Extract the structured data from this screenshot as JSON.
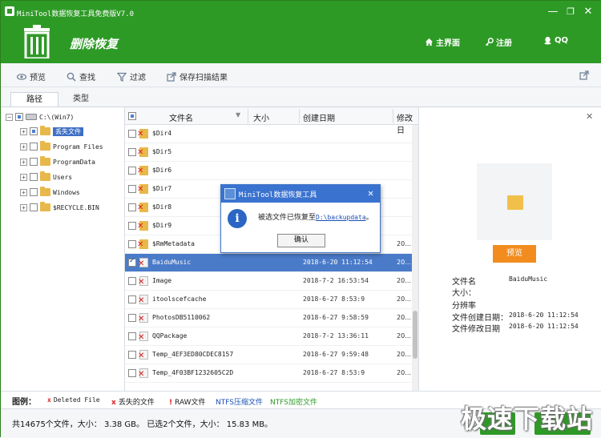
{
  "window": {
    "title": "MiniTool数据恢复工具免费版V7.0",
    "minimize": "—",
    "restore": "❐",
    "close": "✕"
  },
  "header": {
    "title": "删除恢复",
    "nav": [
      {
        "label": "主界面",
        "icon": "home-icon"
      },
      {
        "label": "注册",
        "icon": "key-icon"
      },
      {
        "label": "QQ",
        "icon": "qq-icon"
      }
    ]
  },
  "toolbar": {
    "preview": "预览",
    "find": "查找",
    "filter": "过滤",
    "save_scan": "保存扫描结果"
  },
  "tabs": [
    "路径",
    "类型"
  ],
  "tree": [
    {
      "label": "C:\\(Win7)",
      "level": 0
    },
    {
      "label": "丢失文件",
      "level": 1,
      "selected": true
    },
    {
      "label": "Program Files",
      "level": 1
    },
    {
      "label": "ProgramData",
      "level": 1
    },
    {
      "label": "Users",
      "level": 1
    },
    {
      "label": "Windows",
      "level": 1
    },
    {
      "label": "$RECYCLE.BIN",
      "level": 1
    }
  ],
  "list": {
    "headers": {
      "name": "文件名",
      "size": "大小",
      "created": "创建日期",
      "modified": "修改日"
    },
    "rows": [
      {
        "name": "$Dir4",
        "date": "",
        "mod": "",
        "type": "folder"
      },
      {
        "name": "$Dir5",
        "date": "",
        "mod": "",
        "type": "folder"
      },
      {
        "name": "$Dir6",
        "date": "",
        "mod": "",
        "type": "folder"
      },
      {
        "name": "$Dir7",
        "date": "",
        "mod": "",
        "type": "folder"
      },
      {
        "name": "$Dir8",
        "date": "",
        "mod": "",
        "type": "folder"
      },
      {
        "name": "$Dir9",
        "date": "",
        "mod": "",
        "type": "folder"
      },
      {
        "name": "$RmMetadata",
        "date": "",
        "mod": "20…",
        "type": "folder"
      },
      {
        "name": "BaiduMusic",
        "date": "2018-6-20 11:12:54",
        "mod": "20…",
        "type": "deleted",
        "selected": true
      },
      {
        "name": "Image",
        "date": "2018-7-2 16:53:54",
        "mod": "20…",
        "type": "deleted"
      },
      {
        "name": "itoolscefcache",
        "date": "2018-6-27 8:53:9",
        "mod": "20…",
        "type": "deleted"
      },
      {
        "name": "PhotosDB5110062",
        "date": "2018-6-27 9:58:59",
        "mod": "20…",
        "type": "deleted"
      },
      {
        "name": "QQPackage",
        "date": "2018-7-2 13:36:11",
        "mod": "20…",
        "type": "deleted"
      },
      {
        "name": "Temp_4EF3ED80CDEC8157",
        "date": "2018-6-27 9:59:48",
        "mod": "20…",
        "type": "deleted"
      },
      {
        "name": "Temp_4F03BF1232605C2D",
        "date": "2018-6-27 8:53:9",
        "mod": "20…",
        "type": "deleted"
      }
    ]
  },
  "preview": {
    "button": "预览",
    "fields": [
      {
        "label": "文件名",
        "value": "BaiduMusic"
      },
      {
        "label": "大小：",
        "value": ""
      },
      {
        "label": "分辨率",
        "value": ""
      },
      {
        "label": "文件创建日期：",
        "value": "2018-6-20 11:12:54"
      },
      {
        "label": "文件修改日期",
        "value": "2018-6-20 11:12:54"
      }
    ]
  },
  "legend": {
    "title": "图例：",
    "deleted": "Deleted File",
    "lost": "丢失的文件",
    "raw": "RAW文件",
    "ntfs_compressed": "NTFS压缩文件",
    "ntfs_encrypted": "NTFS加密文件"
  },
  "status": {
    "text": "共14675个文件，大小： 3.38 GB。 已选2个文件，大小： 15.83 MB。",
    "btn1": "",
    "btn2": "",
    "watermark": "极速下载站"
  },
  "dialog": {
    "title": "MiniTool数据恢复工具",
    "message": "被选文件已恢复至",
    "path": "D:\\backupdata",
    "suffix": "。",
    "ok": "确认"
  },
  "colors": {
    "brand_green": "#2e9a26",
    "selection_blue": "#4a7bc9",
    "dialog_blue": "#3a72cf",
    "preview_orange": "#f28c1e",
    "deleted_red": "#d81e1e",
    "ntfs_compressed": "#1a4fb5",
    "ntfs_encrypted": "#2e9a26"
  }
}
